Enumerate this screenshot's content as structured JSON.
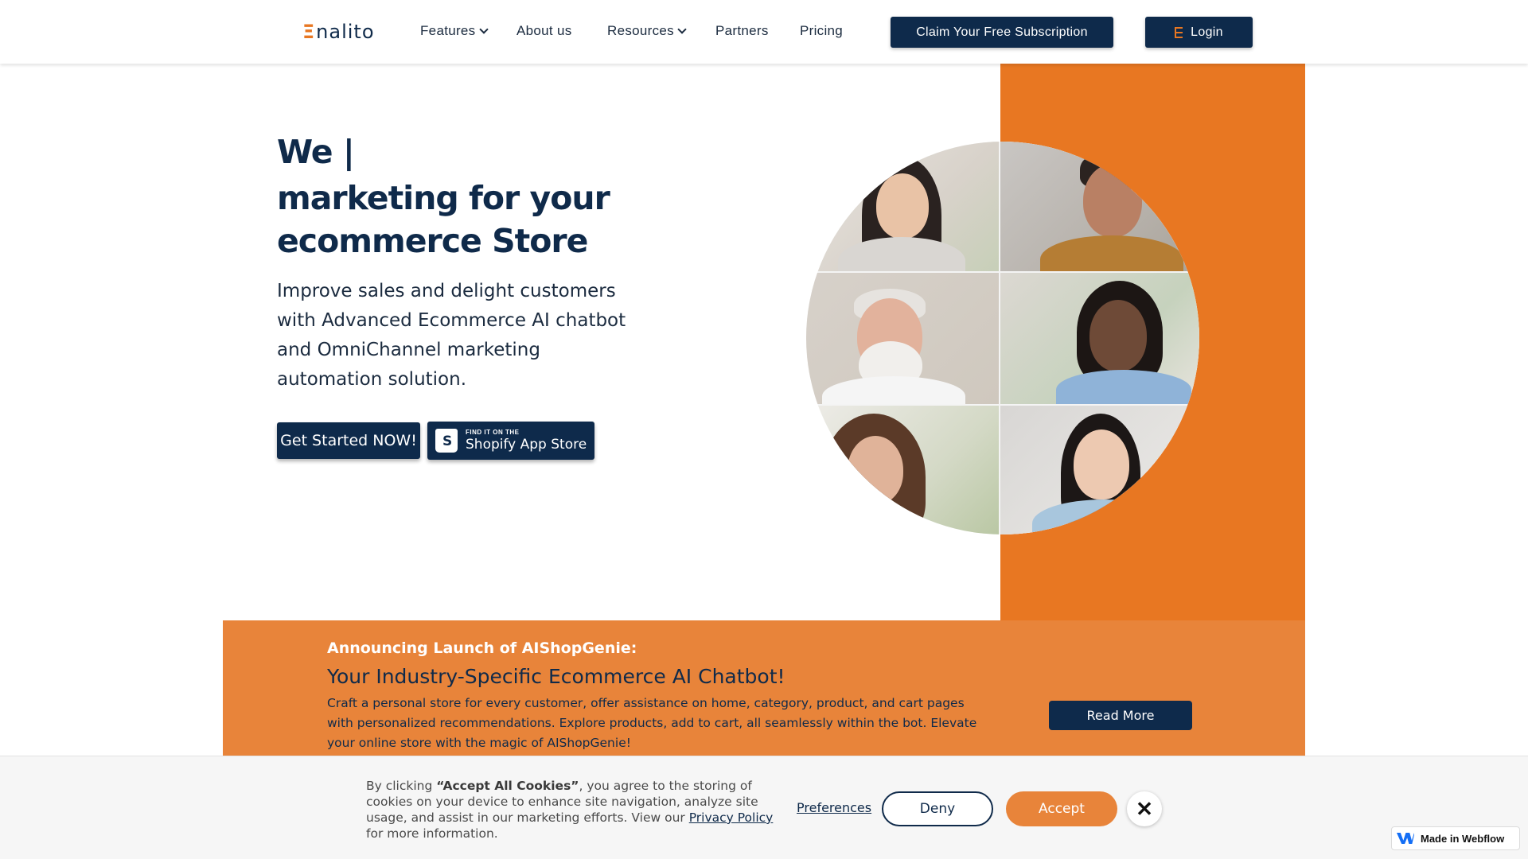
{
  "nav": {
    "logo_mark": "Ξ",
    "logo_text": "nalito",
    "items": [
      {
        "label": "Features",
        "dropdown": true
      },
      {
        "label": "About us",
        "dropdown": false
      },
      {
        "label": "Resources",
        "dropdown": true
      },
      {
        "label": "Partners",
        "dropdown": false
      },
      {
        "label": "Pricing",
        "dropdown": false
      }
    ],
    "claim_button": "Claim Your Free Subscription",
    "login_button": "Login"
  },
  "hero": {
    "title_line1": "We |",
    "title_line2": "marketing for your ecommerce Store",
    "subtitle": "Improve sales and delight customers with Advanced Ecommerce AI chatbot and OmniChannel marketing automation solution.",
    "cta_primary": "Get Started NOW!",
    "shopify_small": "FIND IT ON THE",
    "shopify_big": "Shopify App Store"
  },
  "announcement": {
    "kicker": "Announcing Launch of AIShopGenie:",
    "title": "Your Industry-Specific Ecommerce AI Chatbot!",
    "body": "Craft a personal store for every customer, offer assistance on home, category, product, and cart pages with personalized recommendations. Explore products, add to cart, all seamlessly within the bot. Elevate your online store with the magic of AIShopGenie!",
    "button": "Read More"
  },
  "cookie": {
    "prefix": "By clicking ",
    "bold": "“Accept All Cookies”",
    "middle": ", you agree to the storing of cookies on your device to enhance site navigation, analyze site usage, and assist in our marketing efforts. View our ",
    "link": "Privacy Policy",
    "suffix": " for more information.",
    "preferences": "Preferences",
    "deny": "Deny",
    "accept": "Accept",
    "close": "✕"
  },
  "badge": {
    "label": "Made in Webflow"
  },
  "colors": {
    "brand_navy": "#0e2a4b",
    "brand_orange": "#e87722",
    "announce_orange": "#e8843a"
  },
  "icons": [
    "chevron-down-icon",
    "login-icon",
    "shopify-bag-icon",
    "close-icon",
    "webflow-logo-icon"
  ]
}
